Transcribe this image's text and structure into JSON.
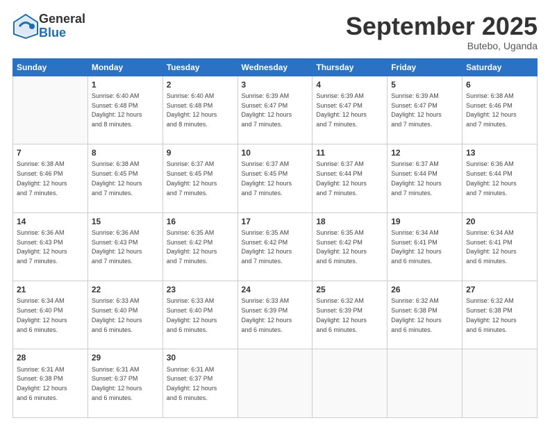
{
  "logo": {
    "general": "General",
    "blue": "Blue"
  },
  "header": {
    "month": "September 2025",
    "location": "Butebo, Uganda"
  },
  "weekdays": [
    "Sunday",
    "Monday",
    "Tuesday",
    "Wednesday",
    "Thursday",
    "Friday",
    "Saturday"
  ],
  "weeks": [
    [
      {
        "day": "",
        "info": ""
      },
      {
        "day": "1",
        "info": "Sunrise: 6:40 AM\nSunset: 6:48 PM\nDaylight: 12 hours\nand 8 minutes."
      },
      {
        "day": "2",
        "info": "Sunrise: 6:40 AM\nSunset: 6:48 PM\nDaylight: 12 hours\nand 8 minutes."
      },
      {
        "day": "3",
        "info": "Sunrise: 6:39 AM\nSunset: 6:47 PM\nDaylight: 12 hours\nand 7 minutes."
      },
      {
        "day": "4",
        "info": "Sunrise: 6:39 AM\nSunset: 6:47 PM\nDaylight: 12 hours\nand 7 minutes."
      },
      {
        "day": "5",
        "info": "Sunrise: 6:39 AM\nSunset: 6:47 PM\nDaylight: 12 hours\nand 7 minutes."
      },
      {
        "day": "6",
        "info": "Sunrise: 6:38 AM\nSunset: 6:46 PM\nDaylight: 12 hours\nand 7 minutes."
      }
    ],
    [
      {
        "day": "7",
        "info": "Sunrise: 6:38 AM\nSunset: 6:46 PM\nDaylight: 12 hours\nand 7 minutes."
      },
      {
        "day": "8",
        "info": "Sunrise: 6:38 AM\nSunset: 6:45 PM\nDaylight: 12 hours\nand 7 minutes."
      },
      {
        "day": "9",
        "info": "Sunrise: 6:37 AM\nSunset: 6:45 PM\nDaylight: 12 hours\nand 7 minutes."
      },
      {
        "day": "10",
        "info": "Sunrise: 6:37 AM\nSunset: 6:45 PM\nDaylight: 12 hours\nand 7 minutes."
      },
      {
        "day": "11",
        "info": "Sunrise: 6:37 AM\nSunset: 6:44 PM\nDaylight: 12 hours\nand 7 minutes."
      },
      {
        "day": "12",
        "info": "Sunrise: 6:37 AM\nSunset: 6:44 PM\nDaylight: 12 hours\nand 7 minutes."
      },
      {
        "day": "13",
        "info": "Sunrise: 6:36 AM\nSunset: 6:44 PM\nDaylight: 12 hours\nand 7 minutes."
      }
    ],
    [
      {
        "day": "14",
        "info": "Sunrise: 6:36 AM\nSunset: 6:43 PM\nDaylight: 12 hours\nand 7 minutes."
      },
      {
        "day": "15",
        "info": "Sunrise: 6:36 AM\nSunset: 6:43 PM\nDaylight: 12 hours\nand 7 minutes."
      },
      {
        "day": "16",
        "info": "Sunrise: 6:35 AM\nSunset: 6:42 PM\nDaylight: 12 hours\nand 7 minutes."
      },
      {
        "day": "17",
        "info": "Sunrise: 6:35 AM\nSunset: 6:42 PM\nDaylight: 12 hours\nand 7 minutes."
      },
      {
        "day": "18",
        "info": "Sunrise: 6:35 AM\nSunset: 6:42 PM\nDaylight: 12 hours\nand 6 minutes."
      },
      {
        "day": "19",
        "info": "Sunrise: 6:34 AM\nSunset: 6:41 PM\nDaylight: 12 hours\nand 6 minutes."
      },
      {
        "day": "20",
        "info": "Sunrise: 6:34 AM\nSunset: 6:41 PM\nDaylight: 12 hours\nand 6 minutes."
      }
    ],
    [
      {
        "day": "21",
        "info": "Sunrise: 6:34 AM\nSunset: 6:40 PM\nDaylight: 12 hours\nand 6 minutes."
      },
      {
        "day": "22",
        "info": "Sunrise: 6:33 AM\nSunset: 6:40 PM\nDaylight: 12 hours\nand 6 minutes."
      },
      {
        "day": "23",
        "info": "Sunrise: 6:33 AM\nSunset: 6:40 PM\nDaylight: 12 hours\nand 6 minutes."
      },
      {
        "day": "24",
        "info": "Sunrise: 6:33 AM\nSunset: 6:39 PM\nDaylight: 12 hours\nand 6 minutes."
      },
      {
        "day": "25",
        "info": "Sunrise: 6:32 AM\nSunset: 6:39 PM\nDaylight: 12 hours\nand 6 minutes."
      },
      {
        "day": "26",
        "info": "Sunrise: 6:32 AM\nSunset: 6:38 PM\nDaylight: 12 hours\nand 6 minutes."
      },
      {
        "day": "27",
        "info": "Sunrise: 6:32 AM\nSunset: 6:38 PM\nDaylight: 12 hours\nand 6 minutes."
      }
    ],
    [
      {
        "day": "28",
        "info": "Sunrise: 6:31 AM\nSunset: 6:38 PM\nDaylight: 12 hours\nand 6 minutes."
      },
      {
        "day": "29",
        "info": "Sunrise: 6:31 AM\nSunset: 6:37 PM\nDaylight: 12 hours\nand 6 minutes."
      },
      {
        "day": "30",
        "info": "Sunrise: 6:31 AM\nSunset: 6:37 PM\nDaylight: 12 hours\nand 6 minutes."
      },
      {
        "day": "",
        "info": ""
      },
      {
        "day": "",
        "info": ""
      },
      {
        "day": "",
        "info": ""
      },
      {
        "day": "",
        "info": ""
      }
    ]
  ]
}
